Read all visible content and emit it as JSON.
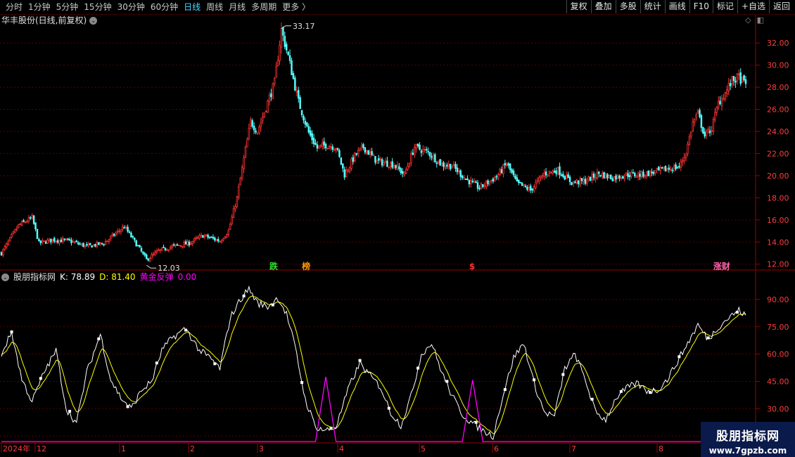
{
  "toolbar": {
    "periods": [
      "分时",
      "1分钟",
      "5分钟",
      "15分钟",
      "30分钟",
      "60分钟",
      "日线",
      "周线",
      "月线",
      "多周期",
      "更多 〉"
    ],
    "active_period": "日线",
    "actions": [
      "复权",
      "叠加",
      "多股",
      "统计",
      "画线",
      "F10",
      "标记",
      "+自选",
      "返回"
    ]
  },
  "main_chart": {
    "title": "华丰股份(日线,前复权)",
    "high_label": "33.17",
    "low_label": "12.03",
    "y_ticks": [
      "32.00",
      "30.00",
      "28.00",
      "26.00",
      "24.00",
      "22.00",
      "20.00",
      "18.00",
      "16.00",
      "14.00",
      "12.00"
    ],
    "markers": [
      {
        "text": "跌",
        "color": "#33dd33"
      },
      {
        "text": "榜",
        "color": "#ff9900"
      },
      {
        "text": "$",
        "color": "#ff3333"
      },
      {
        "text": "涨财",
        "color": "#ff66aa"
      }
    ]
  },
  "indicator": {
    "name": "股朋指标网",
    "k_label": "K: 78.89",
    "d_label": "D: 81.40",
    "signal_label": "黄金反弹",
    "signal_value": "0.00",
    "y_ticks": [
      "90.00",
      "75.00",
      "60.00",
      "45.00",
      "30.00",
      "15.00"
    ]
  },
  "x_axis": {
    "labels": [
      "2024年",
      "12",
      "1",
      "2",
      "3",
      "4",
      "5",
      "6",
      "7",
      "8"
    ]
  },
  "watermark": {
    "line1": "股朋指标网",
    "line2": "www.7gpzb.com"
  },
  "colors": {
    "up": "#ff3232",
    "down": "#54fcfc",
    "k_line": "#ffffff",
    "d_line": "#ffff00",
    "signal": "#ff00ff",
    "grid": "#5a0000",
    "axis": "#a00000"
  },
  "chart_data": {
    "type": "candlestick",
    "price_range": [
      11.6,
      33.6
    ],
    "indicator_range": [
      12,
      100
    ],
    "close_anchors": [
      [
        0,
        13.0
      ],
      [
        10,
        15.5
      ],
      [
        18,
        16.2
      ],
      [
        22,
        13.9
      ],
      [
        30,
        14.2
      ],
      [
        40,
        14.1
      ],
      [
        50,
        13.6
      ],
      [
        60,
        13.9
      ],
      [
        72,
        15.4
      ],
      [
        80,
        13.6
      ],
      [
        85,
        12.4
      ],
      [
        92,
        13.2
      ],
      [
        100,
        13.6
      ],
      [
        110,
        13.9
      ],
      [
        118,
        14.6
      ],
      [
        128,
        14.1
      ],
      [
        133,
        15.0
      ],
      [
        138,
        18.0
      ],
      [
        142,
        21.5
      ],
      [
        146,
        24.9
      ],
      [
        150,
        24.0
      ],
      [
        155,
        26.2
      ],
      [
        160,
        28.4
      ],
      [
        164,
        33.17
      ],
      [
        168,
        30.8
      ],
      [
        174,
        26.7
      ],
      [
        180,
        23.9
      ],
      [
        185,
        22.5
      ],
      [
        190,
        22.8
      ],
      [
        196,
        22.6
      ],
      [
        201,
        20.1
      ],
      [
        207,
        21.8
      ],
      [
        212,
        22.6
      ],
      [
        220,
        21.3
      ],
      [
        230,
        21.0
      ],
      [
        236,
        20.1
      ],
      [
        242,
        22.6
      ],
      [
        250,
        22.1
      ],
      [
        258,
        21.0
      ],
      [
        264,
        20.9
      ],
      [
        272,
        19.7
      ],
      [
        280,
        18.9
      ],
      [
        290,
        19.9
      ],
      [
        296,
        21.1
      ],
      [
        302,
        19.3
      ],
      [
        310,
        18.7
      ],
      [
        318,
        20.2
      ],
      [
        326,
        20.5
      ],
      [
        334,
        19.4
      ],
      [
        342,
        19.5
      ],
      [
        350,
        20.2
      ],
      [
        358,
        19.8
      ],
      [
        366,
        20.1
      ],
      [
        374,
        20.1
      ],
      [
        382,
        20.3
      ],
      [
        390,
        20.6
      ],
      [
        397,
        20.8
      ],
      [
        401,
        22.1
      ],
      [
        405,
        24.8
      ],
      [
        408,
        25.6
      ],
      [
        412,
        23.6
      ],
      [
        416,
        24.3
      ],
      [
        420,
        26.6
      ],
      [
        424,
        27.5
      ],
      [
        428,
        28.6
      ],
      [
        432,
        28.9
      ],
      [
        436,
        28.2
      ]
    ],
    "series": [
      {
        "name": "K"
      },
      {
        "name": "D"
      },
      {
        "name": "黄金反弹",
        "values": [
          0,
          1,
          0,
          1
        ]
      }
    ],
    "k_anchors": [
      [
        0,
        60
      ],
      [
        6,
        72
      ],
      [
        12,
        46
      ],
      [
        18,
        34
      ],
      [
        25,
        50
      ],
      [
        32,
        62
      ],
      [
        38,
        30
      ],
      [
        44,
        22
      ],
      [
        50,
        50
      ],
      [
        58,
        71
      ],
      [
        64,
        46
      ],
      [
        70,
        36
      ],
      [
        76,
        30
      ],
      [
        82,
        40
      ],
      [
        88,
        45
      ],
      [
        94,
        62
      ],
      [
        100,
        69
      ],
      [
        108,
        74
      ],
      [
        116,
        62
      ],
      [
        122,
        58
      ],
      [
        128,
        52
      ],
      [
        134,
        80
      ],
      [
        140,
        90
      ],
      [
        145,
        96
      ],
      [
        150,
        88
      ],
      [
        156,
        86
      ],
      [
        162,
        91
      ],
      [
        167,
        82
      ],
      [
        172,
        64
      ],
      [
        178,
        35
      ],
      [
        184,
        20
      ],
      [
        190,
        18
      ],
      [
        196,
        20
      ],
      [
        204,
        43
      ],
      [
        210,
        55
      ],
      [
        216,
        48
      ],
      [
        222,
        42
      ],
      [
        228,
        28
      ],
      [
        234,
        21
      ],
      [
        240,
        37
      ],
      [
        246,
        60
      ],
      [
        252,
        66
      ],
      [
        258,
        50
      ],
      [
        264,
        37
      ],
      [
        270,
        27
      ],
      [
        276,
        22
      ],
      [
        282,
        18
      ],
      [
        288,
        15
      ],
      [
        294,
        38
      ],
      [
        300,
        58
      ],
      [
        306,
        66
      ],
      [
        312,
        44
      ],
      [
        318,
        28
      ],
      [
        324,
        26
      ],
      [
        330,
        52
      ],
      [
        336,
        60
      ],
      [
        342,
        46
      ],
      [
        348,
        28
      ],
      [
        354,
        24
      ],
      [
        360,
        36
      ],
      [
        366,
        41
      ],
      [
        372,
        44
      ],
      [
        378,
        40
      ],
      [
        384,
        40
      ],
      [
        390,
        46
      ],
      [
        396,
        56
      ],
      [
        402,
        66
      ],
      [
        408,
        76
      ],
      [
        414,
        68
      ],
      [
        420,
        75
      ],
      [
        426,
        80
      ],
      [
        432,
        84
      ],
      [
        436,
        81
      ]
    ],
    "signal_spikes": [
      [
        190,
        40
      ],
      [
        276,
        38
      ]
    ]
  }
}
